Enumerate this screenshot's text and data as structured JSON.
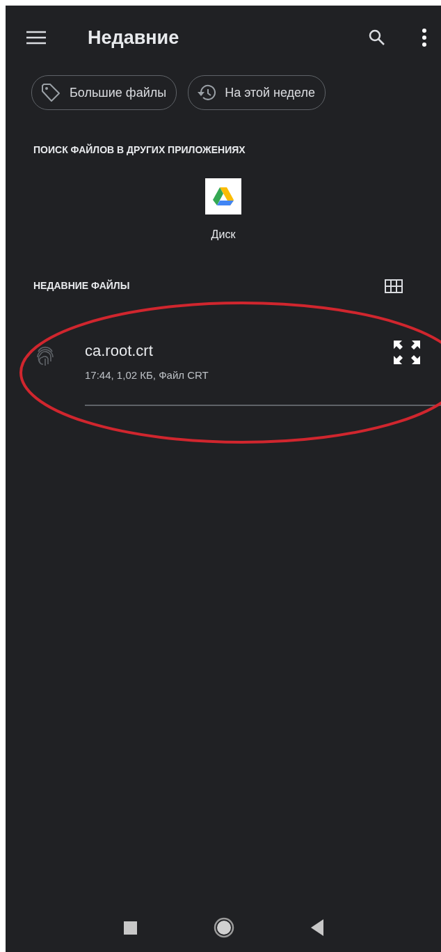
{
  "toolbar": {
    "title": "Недавние"
  },
  "chips": [
    {
      "kind": "tag",
      "label": "Большие файлы"
    },
    {
      "kind": "history",
      "label": "На этой неделе"
    }
  ],
  "other_apps": {
    "heading": "ПОИСК ФАЙЛОВ В ДРУГИХ ПРИЛОЖЕНИЯХ",
    "apps": [
      {
        "label": "Диск"
      }
    ]
  },
  "recent_files": {
    "heading": "НЕДАВНИЕ ФАЙЛЫ",
    "files": [
      {
        "name": "ca.root.crt",
        "details": "17:44, 1,02 КБ, Файл CRT",
        "highlighted": true
      }
    ]
  }
}
